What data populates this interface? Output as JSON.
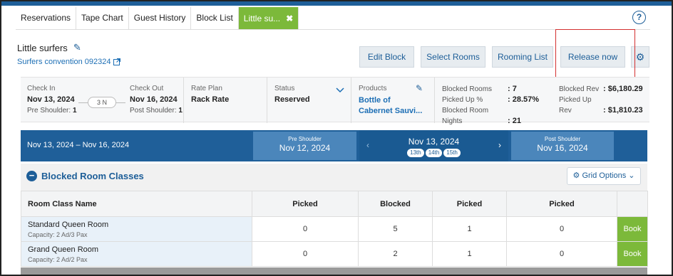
{
  "tabs": [
    {
      "label": "Reservations"
    },
    {
      "label": "Tape Chart"
    },
    {
      "label": "Guest History"
    },
    {
      "label": "Block List"
    },
    {
      "label": "Little su..."
    }
  ],
  "help_glyph": "?",
  "header": {
    "title": "Little surfers",
    "sub_link": "Surfers convention 092324"
  },
  "actions": {
    "edit_block": "Edit Block",
    "select_rooms": "Select Rooms",
    "rooming_list": "Rooming List",
    "release_now": "Release now"
  },
  "info": {
    "check_in_label": "Check In",
    "check_in": "Nov 13, 2024",
    "pre_shoulder_label": "Pre Shoulder:",
    "pre_shoulder": "1",
    "nights": "3 N",
    "check_out_label": "Check Out",
    "check_out": "Nov 16, 2024",
    "post_shoulder_label": "Post Shoulder:",
    "post_shoulder": "1",
    "rate_plan_label": "Rate Plan",
    "rate_plan": "Rack Rate",
    "status_label": "Status",
    "status": "Reserved",
    "products_label": "Products",
    "product_line1": "Bottle of",
    "product_line2": "Cabernet Sauvi...",
    "blocked_rooms_label": "Blocked Rooms",
    "blocked_rooms": ": 7",
    "picked_up_pct_label": "Picked Up %",
    "picked_up_pct": ": 28.57%",
    "blocked_nights_label": "Blocked Room Nights",
    "blocked_nights": ": 21",
    "blocked_rev_label": "Blocked Rev",
    "blocked_rev": ": $6,180.29",
    "picked_up_rev_label": "Picked Up Rev",
    "picked_up_rev": ": $1,810.23"
  },
  "datebar": {
    "range": "Nov 13, 2024 – Nov 16, 2024",
    "pre_label": "Pre Shoulder",
    "pre_date": "Nov 12, 2024",
    "current_date": "Nov 13, 2024",
    "days": [
      "13th",
      "14th",
      "15th"
    ],
    "post_label": "Post Shoulder",
    "post_date": "Nov 16, 2024"
  },
  "section": {
    "title": "Blocked Room Classes",
    "grid_options": "Grid Options"
  },
  "table": {
    "headers": [
      "Room Class Name",
      "Picked",
      "Blocked",
      "Picked",
      "Picked"
    ],
    "rows": [
      {
        "name": "Standard Queen Room",
        "capacity": "Capacity: 2 Ad/3 Pax",
        "c1": "0",
        "c2": "5",
        "c3": "1",
        "c4": "0",
        "action": "Book"
      },
      {
        "name": "Grand Queen Room",
        "capacity": "Capacity: 2 Ad/2 Pax",
        "c1": "0",
        "c2": "2",
        "c3": "1",
        "c4": "0",
        "action": "Book"
      }
    ]
  },
  "colors": {
    "brand_blue": "#1f5f99",
    "green": "#7cb93a",
    "highlight_red": "#d32f2f"
  }
}
